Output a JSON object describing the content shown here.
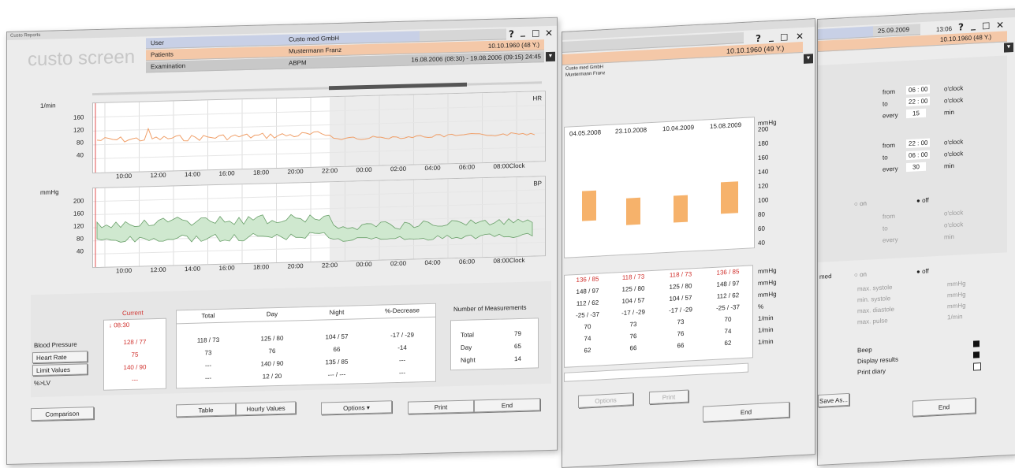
{
  "main": {
    "title": "Custo Reports",
    "logo": "custo screen",
    "user_label": "User",
    "user_value": "Custo med GmbH",
    "patients_label": "Patients",
    "patient_name": "Mustermann Franz",
    "patient_dob": "10.10.1960 (48 Y.)",
    "exam_label": "Examination",
    "exam_type": "ABPM",
    "exam_range": "16.08.2006 (08:30) - 19.08.2006 (09:15)  24:45",
    "hr_axis_label": "1/min",
    "hr_tag": "HR",
    "hr_yticks": [
      "160",
      "120",
      "80",
      "40"
    ],
    "bp_axis_label": "mmHg",
    "bp_tag": "BP",
    "bp_yticks": [
      "200",
      "160",
      "120",
      "80",
      "40"
    ],
    "xticks": [
      "10:00",
      "12:00",
      "14:00",
      "16:00",
      "18:00",
      "20:00",
      "22:00",
      "00:00",
      "02:00",
      "04:00",
      "06:00",
      "08:00Clock"
    ],
    "current_header": "Current",
    "current_time": "08:30",
    "row_labels": [
      "Blood Pressure",
      "Heart Rate",
      "Limit Values",
      "%>LV"
    ],
    "current_values": [
      "128 / 77",
      "75",
      "140 / 90",
      "---"
    ],
    "col_headers": [
      "Total",
      "Day",
      "Night",
      "%-Decrease"
    ],
    "rows": [
      [
        "118 / 73",
        "125 / 80",
        "104 / 57",
        "-17 / -29"
      ],
      [
        "73",
        "76",
        "66",
        "-14"
      ],
      [
        "---",
        "140 / 90",
        "135 / 85",
        "---"
      ],
      [
        "---",
        "12 / 20",
        "--- / ---",
        "---"
      ]
    ],
    "measure_header": "Number of Measurements",
    "measure_rows": [
      [
        "Total",
        "79"
      ],
      [
        "Day",
        "65"
      ],
      [
        "Night",
        "14"
      ]
    ],
    "buttons": {
      "comparison": "Comparison",
      "table": "Table",
      "hourly": "Hourly Values",
      "options": "Options",
      "print": "Print",
      "end": "End"
    }
  },
  "middle": {
    "patient_dob": "10.10.1960 (49 Y.)",
    "user_value": "Custo med GmbH",
    "patient_name": "Mustermann Franz",
    "dates": [
      "04.05.2008",
      "23.10.2008",
      "10.04.2009",
      "15.08.2009"
    ],
    "yunit": "mmHg",
    "yticks": [
      "200",
      "180",
      "160",
      "140",
      "120",
      "100",
      "80",
      "60",
      "40"
    ],
    "top_row": [
      "136 / 85",
      "118 / 73",
      "118 / 73",
      "136 / 85"
    ],
    "table_rows": [
      [
        "148 / 97",
        "125 / 80",
        "125 / 80",
        "148 / 97"
      ],
      [
        "112 / 62",
        "104 / 57",
        "104 / 57",
        "112 / 62"
      ],
      [
        "-25 / -37",
        "-17 / -29",
        "-17 / -29",
        "-25 / -37"
      ],
      [
        "70",
        "73",
        "73",
        "70"
      ],
      [
        "74",
        "76",
        "76",
        "74"
      ],
      [
        "62",
        "66",
        "66",
        "62"
      ]
    ],
    "units": [
      "mmHg",
      "mmHg",
      "mmHg",
      "%",
      "1/min",
      "1/min",
      "1/min"
    ],
    "buttons": {
      "options": "Options",
      "print": "Print",
      "end": "End"
    }
  },
  "right": {
    "date": "25.09.2009",
    "time": "13:06",
    "patient_dob": "10.10.1960 (48 Y.)",
    "interval_1": {
      "from_label": "from",
      "from_value": "06 : 00",
      "to_label": "to",
      "to_value": "22 : 00",
      "every_label": "every",
      "every_value": "15",
      "clock": "o'clock",
      "min": "min"
    },
    "interval_2": {
      "from_label": "from",
      "from_value": "22 : 00",
      "to_label": "to",
      "to_value": "06 : 00",
      "every_label": "every",
      "every_value": "30",
      "clock": "o'clock",
      "min": "min"
    },
    "on_label": "on",
    "off_label": "off",
    "grey_from": "from",
    "grey_to": "to",
    "grey_every": "every",
    "grey_clock": "o'clock",
    "grey_min": "min",
    "max_labels": [
      "max. systole",
      "min. systole",
      "max. diastole",
      "max. pulse"
    ],
    "max_units": [
      "mmHg",
      "mmHg",
      "mmHg",
      "1/min"
    ],
    "side_label": "med",
    "options": [
      "Beep",
      "Display results",
      "Print diary"
    ],
    "buttons": {
      "save_as": "Save As...",
      "end": "End"
    }
  }
}
